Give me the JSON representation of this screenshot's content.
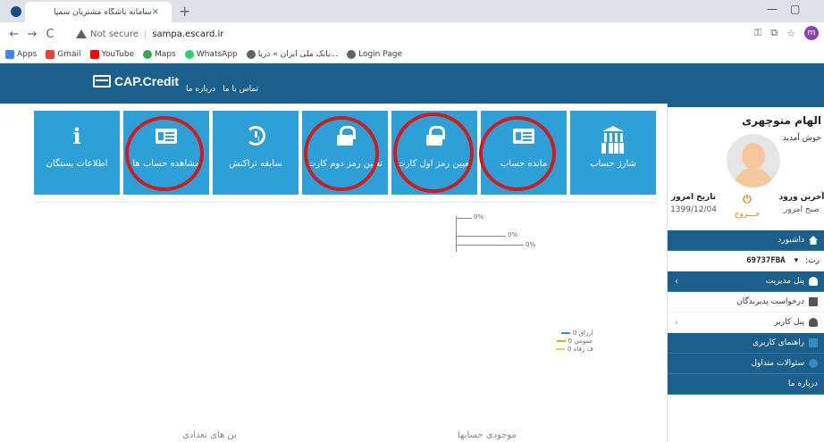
{
  "browser": {
    "tab_title": "سامانه باشگاه مشتریان سمپا",
    "tab_close": "×",
    "new_tab": "+",
    "url_warning": "Not secure",
    "url": "sampa.escard.ir",
    "profile_initial": "m",
    "bookmarks": [
      {
        "label": "Apps",
        "color": "#4285f4"
      },
      {
        "label": "Gmail",
        "color": "#ea4335"
      },
      {
        "label": "YouTube",
        "color": "#ff0000"
      },
      {
        "label": "Maps",
        "color": "#34a853"
      },
      {
        "label": "WhatsApp",
        "color": "#25d366"
      },
      {
        "label": "بانک ملی ایران » دریا...",
        "color": "#5f6368"
      },
      {
        "label": "Login Page",
        "color": "#5f6368"
      }
    ]
  },
  "site": {
    "logo": "CAP.Credit",
    "nav": [
      "درباره ما",
      "تماس با ما"
    ],
    "brand_color": "#1b5f8c",
    "tile_color": "#2ea0d8"
  },
  "tiles": [
    {
      "label": "شارژ حساب",
      "icon": "bank-icon"
    },
    {
      "label": "مانده حساب",
      "icon": "id-card-icon"
    },
    {
      "label": "تعیین رمز اول کارت",
      "icon": "lock-icon"
    },
    {
      "label": "تعیین رمز دوم کارت",
      "icon": "lock-icon"
    },
    {
      "label": "سابقه تراکنش",
      "icon": "history-icon"
    },
    {
      "label": "مشاهده حساب ها",
      "icon": "id-card-icon"
    },
    {
      "label": "اطلاعات بستگان",
      "icon": "info-icon"
    }
  ],
  "chart_top": {
    "labels": [
      "0%",
      "0%",
      "0%"
    ]
  },
  "chart_legend": [
    {
      "label": "ارزاق 0",
      "color": "#3b8ed8"
    },
    {
      "label": "عمومي 0",
      "color": "#e6a817"
    },
    {
      "label": "ف رفاه 0",
      "color": "#e8d44a"
    }
  ],
  "chart_titles": {
    "accounts": "موجودی حسابها",
    "coupons": "بن های تعدادی"
  },
  "user": {
    "name": "الهام منوچهری",
    "welcome": "خوش آمدید",
    "last_login_label": "آخرین ورود",
    "last_login_value": "صبح امروز",
    "logout_icon": "⏻",
    "logout_label": "خـــروج",
    "today_label": "تاریخ امروز",
    "today_value": "1399/12/04"
  },
  "menu": {
    "dashboard": "داشبورد",
    "card_label": "رت:",
    "card_value": "69737FBA",
    "admin_panel": "پنل مدیریت",
    "merchant_request": "درخواست پذیرندگان",
    "user_panel": "پنل کاربر",
    "user_guide": "راهنمای کاربری",
    "faq": "سئوالات متداول",
    "about": "درباره ما"
  }
}
